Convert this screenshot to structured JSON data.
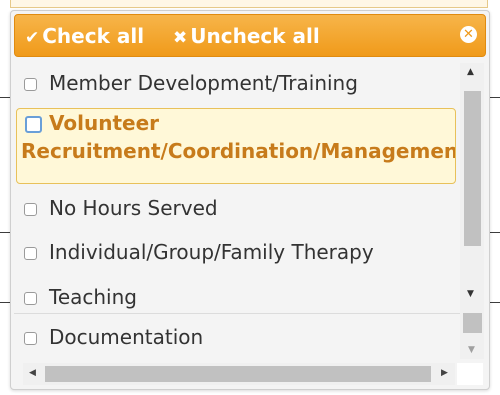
{
  "header": {
    "check_all_icon": "check-icon",
    "check_all_label": "Check all",
    "uncheck_all_icon": "x-icon",
    "uncheck_all_label": "Uncheck all",
    "close_icon": "close-circle-icon",
    "colors": {
      "header_bg": "#f5a623",
      "header_text": "#ffffff",
      "highlight_text": "#c77b1b",
      "highlight_bg": "#fff8d8"
    }
  },
  "list": {
    "items": [
      {
        "label": "Member Development/Training",
        "checked": false
      },
      {
        "label_line1": "Volunteer",
        "label_line2": "Recruitment/Coordination/Management",
        "checked": false,
        "highlighted": true
      },
      {
        "label": "No Hours Served",
        "checked": false
      },
      {
        "label": "Individual/Group/Family Therapy",
        "checked": false
      },
      {
        "label": "Teaching",
        "checked": false
      }
    ]
  },
  "outer_list": {
    "items": [
      {
        "label": "Documentation",
        "checked": false
      }
    ]
  }
}
